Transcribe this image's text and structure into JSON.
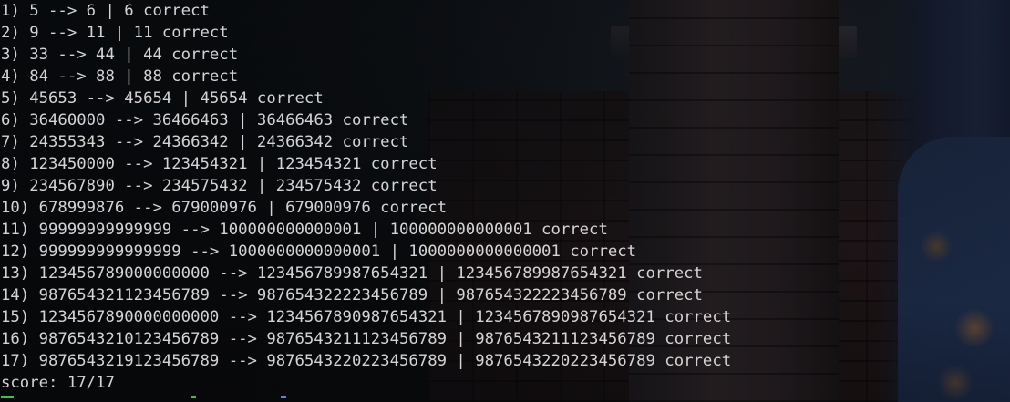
{
  "terminal": {
    "lines": [
      "1) 5 --> 6 | 6 correct",
      "2) 9 --> 11 | 11 correct",
      "3) 33 --> 44 | 44 correct",
      "4) 84 --> 88 | 88 correct",
      "5) 45653 --> 45654 | 45654 correct",
      "6) 36460000 --> 36466463 | 36466463 correct",
      "7) 24355343 --> 24366342 | 24366342 correct",
      "8) 123450000 --> 123454321 | 123454321 correct",
      "9) 234567890 --> 234575432 | 234575432 correct",
      "10) 678999876 --> 679000976 | 679000976 correct",
      "11) 99999999999999 --> 100000000000001 | 100000000000001 correct",
      "12) 999999999999999 --> 1000000000000001 | 1000000000000001 correct",
      "13) 123456789000000000 --> 123456789987654321 | 123456789987654321 correct",
      "14) 987654321123456789 --> 987654322223456789 | 987654322223456789 correct",
      "15) 1234567890000000000 --> 1234567890987654321 | 1234567890987654321 correct",
      "16) 9876543210123456789 --> 9876543211123456789 | 9876543211123456789 correct",
      "17) 9876543219123456789 --> 9876543220223456789 | 9876543220223456789 correct"
    ],
    "score": "score: 17/17"
  },
  "colors": {
    "text": "#d4d4d4",
    "prompt_green": "#3fc13f",
    "prompt_blue": "#3b8eea",
    "prompt_red": "#e05252"
  }
}
